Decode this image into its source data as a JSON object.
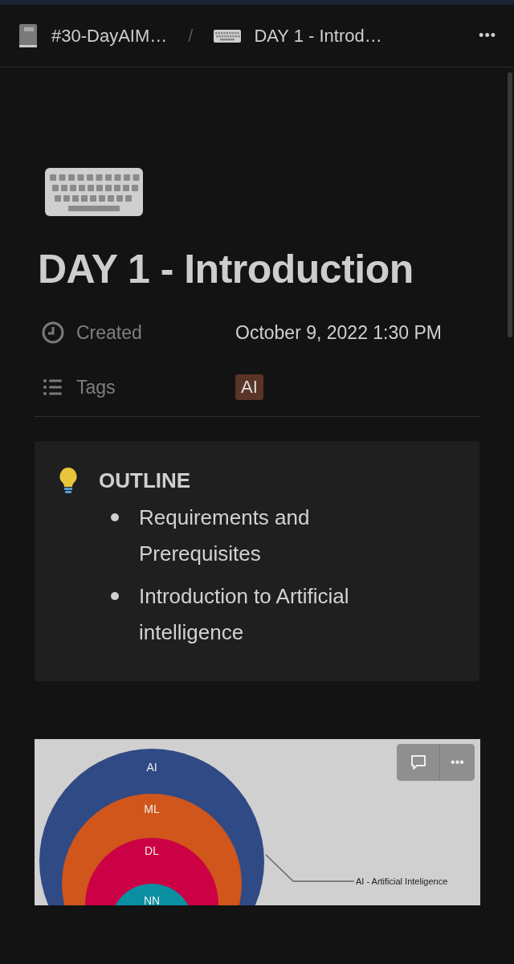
{
  "breadcrumb": [
    {
      "label": "#30-DayAIM…"
    },
    {
      "label": "DAY 1 - Introd…"
    }
  ],
  "separator": "/",
  "more": "•••",
  "page": {
    "title": "DAY 1 - Introduction"
  },
  "properties": [
    {
      "kind": "date",
      "name": "Created",
      "value": "October 9, 2022 1:30 PM"
    },
    {
      "kind": "tags",
      "name": "Tags",
      "tags": [
        {
          "label": "AI",
          "color": "#5a3426"
        }
      ]
    }
  ],
  "callout": {
    "heading": "OUTLINE",
    "items": [
      "Requirements and Prerequisites",
      "Introduction to Artificial intelligence"
    ]
  },
  "diagram": {
    "layers": [
      {
        "label": "AI",
        "color": "#2f4a85"
      },
      {
        "label": "ML",
        "color": "#d0561b"
      },
      {
        "label": "DL",
        "color": "#cc0044"
      },
      {
        "label": "NN",
        "color": "#0a8fa0"
      }
    ],
    "caption": "AI - Artificial Inteligence",
    "toolbar_more": "•••"
  }
}
